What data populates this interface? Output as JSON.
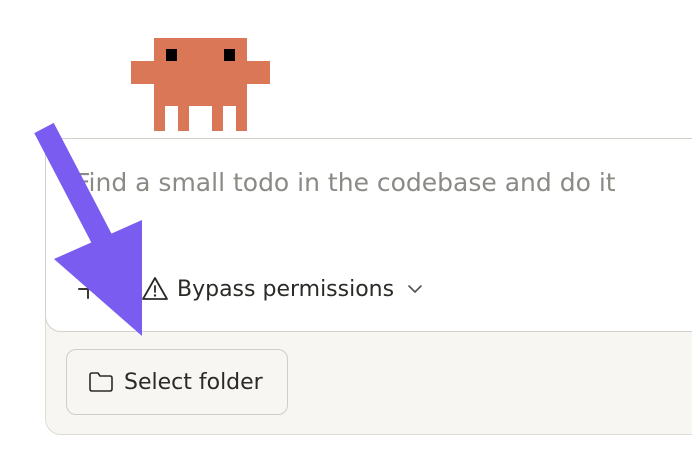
{
  "composer": {
    "placeholder": "Find a small todo in the codebase and do it"
  },
  "toolbar": {
    "add_icon": "plus-icon",
    "permission_mode_label": "Bypass permissions",
    "permission_mode_icon": "warning-triangle-icon",
    "dropdown_icon": "chevron-down-icon"
  },
  "folder_button": {
    "label": "Select folder",
    "icon": "folder-icon"
  },
  "mascot": {
    "icon": "pixel-crab-mascot",
    "color": "#d97757"
  },
  "annotation": {
    "icon": "pointer-arrow",
    "color": "#7a5cf0"
  }
}
